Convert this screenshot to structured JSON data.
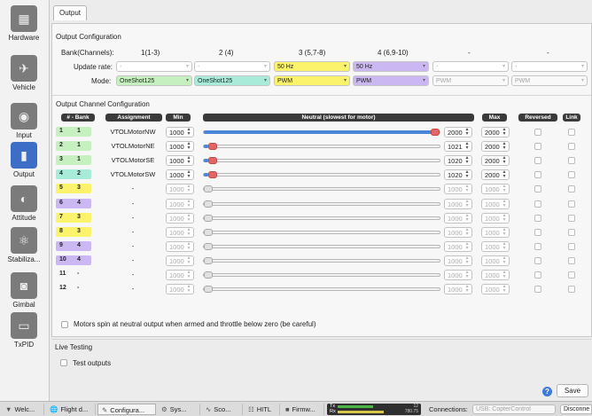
{
  "sidebar": {
    "items": [
      {
        "label": "Hardware",
        "icon": "hardware-icon",
        "glyph": "▦"
      },
      {
        "label": "Vehicle",
        "icon": "vehicle-icon",
        "glyph": "✈"
      },
      {
        "label": "Input",
        "icon": "transmitter-icon",
        "glyph": "◉"
      },
      {
        "label": "Output",
        "icon": "battery-icon",
        "glyph": "▮"
      },
      {
        "label": "Attitude",
        "icon": "attitude-icon",
        "glyph": "◐"
      },
      {
        "label": "Stabiliza...",
        "icon": "stabilization-icon",
        "glyph": "⚛"
      },
      {
        "label": "Gimbal",
        "icon": "camera-icon",
        "glyph": "◙"
      },
      {
        "label": "TxPID",
        "icon": "txpid-icon",
        "glyph": "▭"
      }
    ]
  },
  "tab": {
    "label": "Output"
  },
  "output_config": {
    "title": "Output Configuration",
    "bank_label": "Bank(Channels):",
    "banks": [
      "1(1-3)",
      "2 (4)",
      "3 (5,7-8)",
      "4 (6,9-10)",
      "-",
      "-"
    ],
    "update_rate_label": "Update rate:",
    "update_rates": [
      "-",
      "-",
      "50 Hz",
      "50 Hz",
      "-",
      "-"
    ],
    "mode_label": "Mode:",
    "modes": [
      "OneShot125",
      "OneShot125",
      "PWM",
      "PWM",
      "PWM",
      "PWM"
    ]
  },
  "channel_config": {
    "title": "Output Channel Configuration",
    "headers": {
      "bank": "# - Bank",
      "assignment": "Assignment",
      "min": "Min",
      "neutral": "Neutral (slowest for motor)",
      "max": "Max",
      "reversed": "Reversed",
      "link": "Link"
    },
    "rows": [
      {
        "ch": "1",
        "bank": "1",
        "assignment": "VTOLMotorNW",
        "min": "1000",
        "neutral": "2000",
        "max": "2000",
        "level": 1.0,
        "enabled": true
      },
      {
        "ch": "2",
        "bank": "1",
        "assignment": "VTOLMotorNE",
        "min": "1000",
        "neutral": "1021",
        "max": "2000",
        "level": 0.021,
        "enabled": true
      },
      {
        "ch": "3",
        "bank": "1",
        "assignment": "VTOLMotorSE",
        "min": "1000",
        "neutral": "1020",
        "max": "2000",
        "level": 0.02,
        "enabled": true
      },
      {
        "ch": "4",
        "bank": "2",
        "assignment": "VTOLMotorSW",
        "min": "1000",
        "neutral": "1020",
        "max": "2000",
        "level": 0.02,
        "enabled": true
      },
      {
        "ch": "5",
        "bank": "3",
        "assignment": "-",
        "min": "1000",
        "neutral": "1000",
        "max": "1000",
        "level": 0,
        "enabled": false
      },
      {
        "ch": "6",
        "bank": "4",
        "assignment": "-",
        "min": "1000",
        "neutral": "1000",
        "max": "1000",
        "level": 0,
        "enabled": false
      },
      {
        "ch": "7",
        "bank": "3",
        "assignment": "-",
        "min": "1000",
        "neutral": "1000",
        "max": "1000",
        "level": 0,
        "enabled": false
      },
      {
        "ch": "8",
        "bank": "3",
        "assignment": "-",
        "min": "1000",
        "neutral": "1000",
        "max": "1000",
        "level": 0,
        "enabled": false
      },
      {
        "ch": "9",
        "bank": "4",
        "assignment": "-",
        "min": "1000",
        "neutral": "1000",
        "max": "1000",
        "level": 0,
        "enabled": false
      },
      {
        "ch": "10",
        "bank": "4",
        "assignment": "-",
        "min": "1000",
        "neutral": "1000",
        "max": "1000",
        "level": 0,
        "enabled": false
      },
      {
        "ch": "11",
        "bank": "-",
        "assignment": "-",
        "min": "1000",
        "neutral": "1000",
        "max": "1000",
        "level": 0,
        "enabled": false
      },
      {
        "ch": "12",
        "bank": "-",
        "assignment": "-",
        "min": "1000",
        "neutral": "1000",
        "max": "1000",
        "level": 0,
        "enabled": false
      }
    ],
    "motors_spin_label": "Motors spin at neutral output when armed and throttle below zero (be careful)"
  },
  "bank_colors": {
    "1": "#c7f0c0",
    "2": "#a9ebd9",
    "3": "#fbf36b",
    "4": "#cbb7f2",
    "-": "#f7f7f7"
  },
  "live_testing": {
    "title": "Live Testing",
    "test_outputs_label": "Test outputs"
  },
  "footer": {
    "help_icon": "help-icon",
    "save_label": "Save"
  },
  "taskbar": {
    "tabs": [
      {
        "label": "Welc...",
        "icon": "welcome-icon",
        "glyph": "▼"
      },
      {
        "label": "Flight d...",
        "icon": "globe-icon",
        "glyph": "🌐"
      },
      {
        "label": "Configura...",
        "icon": "wrench-icon",
        "glyph": "✎"
      },
      {
        "label": "Sys...",
        "icon": "gears-icon",
        "glyph": "⚙"
      },
      {
        "label": "Sco...",
        "icon": "scope-icon",
        "glyph": "∿"
      },
      {
        "label": "HITL",
        "icon": "hitl-icon",
        "glyph": "☷"
      },
      {
        "label": "Firmw...",
        "icon": "firmware-icon",
        "glyph": "■"
      }
    ],
    "tx_label": "Tx",
    "rx_label": "Rx",
    "tx_value": "12",
    "rx_value": "780.75",
    "connections_label": "Connections:",
    "connection_value": "USB: CopterControl",
    "disconnect_label": "Disconne"
  }
}
